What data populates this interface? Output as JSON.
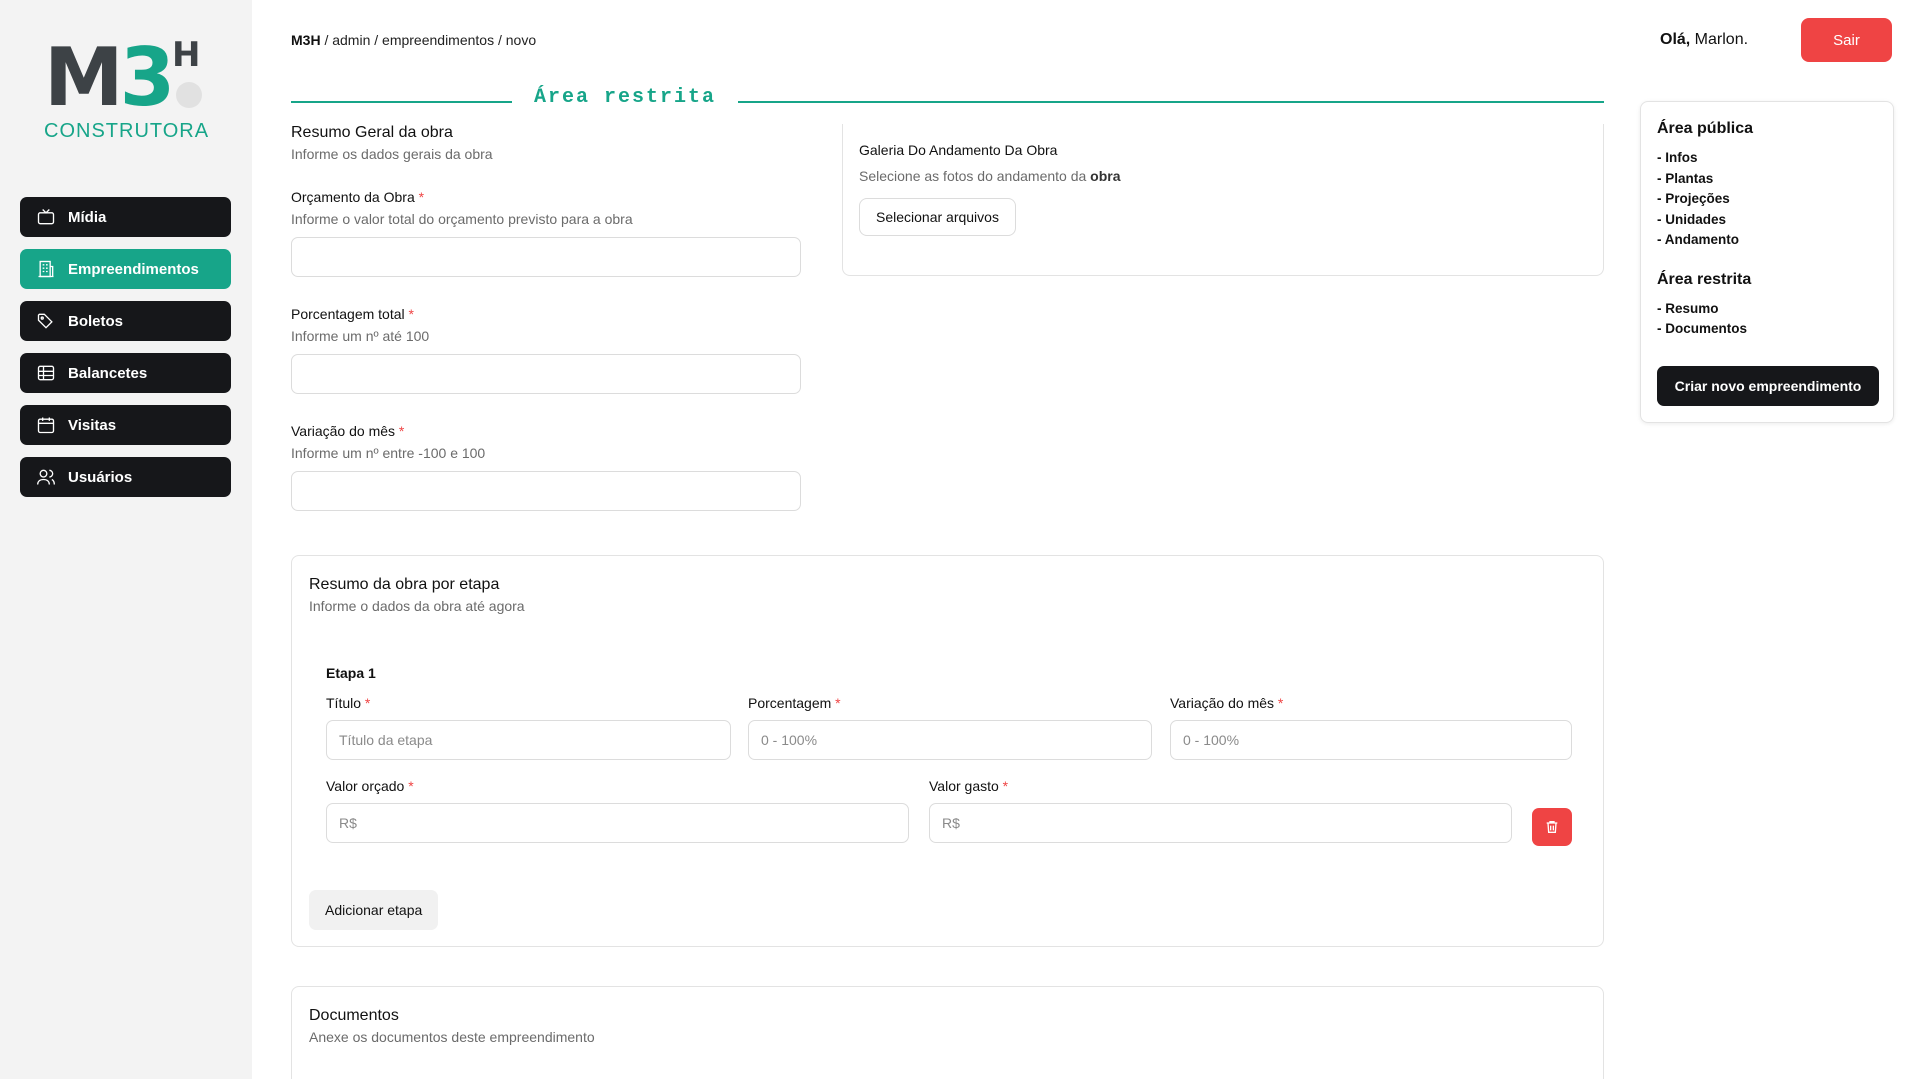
{
  "logo": {
    "mark": "M3",
    "h": "H",
    "subtitle": "CONSTRUTORA"
  },
  "sidebar": {
    "items": [
      {
        "label": "Mídia",
        "icon": "tv-icon",
        "active": false
      },
      {
        "label": "Empreendimentos",
        "icon": "building-icon",
        "active": true
      },
      {
        "label": "Boletos",
        "icon": "tags-icon",
        "active": false
      },
      {
        "label": "Balancetes",
        "icon": "table-icon",
        "active": false
      },
      {
        "label": "Visitas",
        "icon": "calendar-icon",
        "active": false
      },
      {
        "label": "Usuários",
        "icon": "users-icon",
        "active": false
      }
    ]
  },
  "header": {
    "breadcrumb_root": "M3H",
    "breadcrumb_rest": " / admin / empreendimentos / novo",
    "greeting_bold": "Olá,",
    "greeting_name": " Marlon.",
    "logout_label": "Sair"
  },
  "colors": {
    "accent": "#17a589",
    "danger": "#ef4444",
    "dark": "#16171a",
    "sidebar_bg": "#f3f3f3"
  },
  "divider_label": "Área restrita",
  "resumo_geral": {
    "title": "Resumo Geral da obra",
    "description": "Informe os dados gerais da obra",
    "fields": [
      {
        "label": "Orçamento da Obra",
        "required": "*",
        "description": "Informe o valor total do orçamento previsto para a obra",
        "value": ""
      },
      {
        "label": "Porcentagem total",
        "required": "*",
        "description": "Informe um nº até 100",
        "value": ""
      },
      {
        "label": "Variação do mês ",
        "required": "*",
        "description": "Informe um nº entre -100 e 100",
        "value": ""
      }
    ]
  },
  "galeria": {
    "title": "Galeria Do Andamento Da Obra",
    "description": "Selecione as fotos do andamento da ",
    "description_bold": "obra",
    "button_label": "Selecionar arquivos"
  },
  "aside": {
    "publica_title": "Área pública",
    "publica_items": [
      "- Infos",
      "- Plantas",
      "- Projeções",
      "- Unidades",
      "- Andamento"
    ],
    "restrita_title": "Área restrita",
    "restrita_items": [
      "- Resumo",
      "- Documentos"
    ],
    "create_button": "Criar novo empreendimento"
  },
  "etapas": {
    "title": "Resumo da obra por etapa",
    "description": "Informe o dados da obra até agora",
    "etapa_name": "Etapa 1",
    "titulo": {
      "label": "Título",
      "placeholder": "Título da etapa"
    },
    "porcentagem": {
      "label": "Porcentagem",
      "placeholder": "0 - 100%"
    },
    "variacao": {
      "label": "Variação do mês",
      "placeholder": "0 - 100%"
    },
    "valor_orcado": {
      "label": "Valor orçado",
      "placeholder": "R$"
    },
    "valor_gasto": {
      "label": "Valor gasto",
      "placeholder": "R$"
    },
    "required": "*",
    "add_button": "Adicionar etapa"
  },
  "documentos": {
    "title": "Documentos",
    "description": "Anexe os documentos deste empreendimento"
  }
}
